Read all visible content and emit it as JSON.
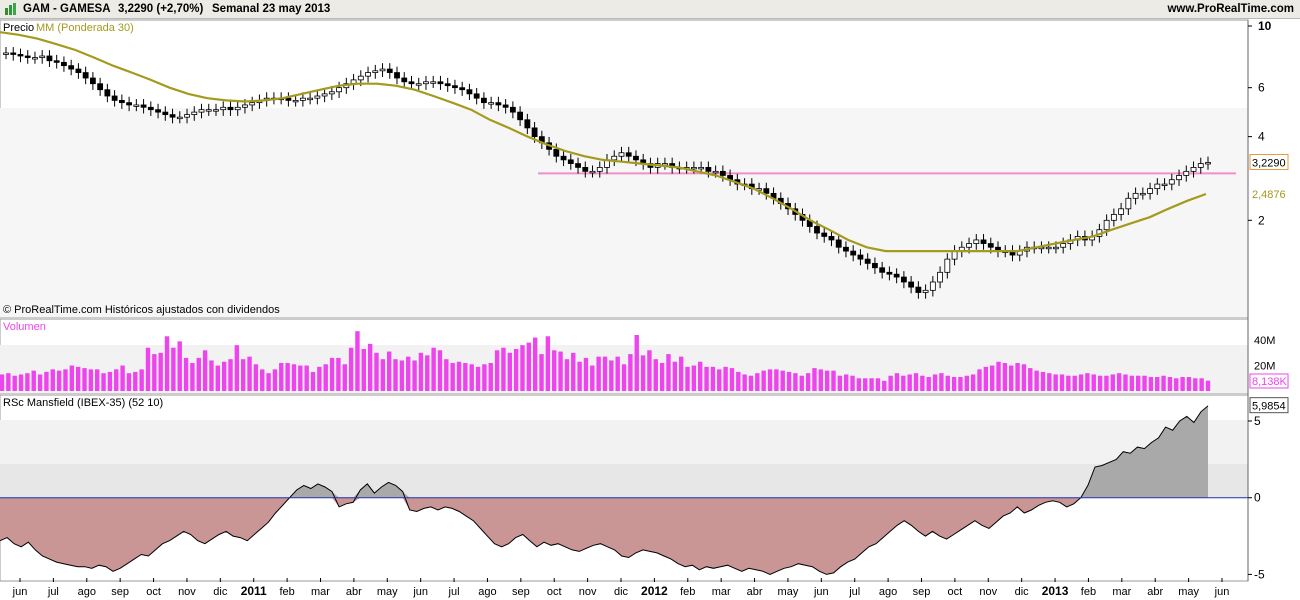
{
  "header": {
    "symbol": "GAM - GAMESA",
    "price_change": "3,2290 (+2,70%)",
    "period": "Semanal  23 may 2013",
    "site": "www.ProRealTime.com",
    "chart_icon": "bar-chart-icon"
  },
  "panels": {
    "price": {
      "label": "Precio",
      "ma_label": "MM (Ponderada 30)",
      "copyright": "© ProRealTime.com  Históricos ajustados con dividendos",
      "last_price_tag": "3,2290",
      "ma_tag": "2,4876",
      "y_ticks": [
        "10",
        "6",
        "4",
        "2"
      ]
    },
    "volume": {
      "label": "Volumen",
      "last_tag": "8,138K",
      "y_ticks": [
        "40M",
        "20M"
      ]
    },
    "rsc": {
      "label": "RSc Mansfield (IBEX-35) (52 10)",
      "last_tag": "5,9854",
      "y_ticks": [
        "5",
        "0",
        "-5"
      ]
    }
  },
  "x_axis": [
    "jun",
    "jul",
    "ago",
    "sep",
    "oct",
    "nov",
    "dic",
    "2011",
    "feb",
    "mar",
    "abr",
    "may",
    "jun",
    "jul",
    "ago",
    "sep",
    "oct",
    "nov",
    "dic",
    "2012",
    "feb",
    "mar",
    "abr",
    "may",
    "jun",
    "jul",
    "ago",
    "sep",
    "oct",
    "nov",
    "dic",
    "2013",
    "feb",
    "mar",
    "abr",
    "may",
    "jun"
  ],
  "colors": {
    "ma": "#a49a1e",
    "volume": "#ee44ee",
    "rsc_negative": "#c99595",
    "rsc_positive": "#a9a9a9",
    "hline": "#f090c8",
    "zero_line": "#2233aa"
  },
  "chart_data": [
    {
      "type": "line",
      "title": "GAM - GAMESA",
      "series": [
        {
          "name": "Precio",
          "values": [
            8.0,
            7.9,
            7.8,
            7.7,
            7.7,
            7.8,
            7.5,
            7.4,
            7.2,
            7.0,
            6.8,
            6.5,
            6.2,
            5.9,
            5.6,
            5.4,
            5.3,
            5.2,
            5.2,
            5.1,
            5.0,
            4.9,
            4.8,
            4.7,
            4.7,
            4.8,
            4.9,
            5.0,
            5.0,
            5.0,
            5.1,
            5.0,
            5.1,
            5.2,
            5.3,
            5.4,
            5.5,
            5.5,
            5.5,
            5.4,
            5.4,
            5.5,
            5.5,
            5.6,
            5.7,
            5.8,
            6.0,
            6.2,
            6.4,
            6.6,
            6.8,
            6.9,
            7.0,
            6.8,
            6.5,
            6.3,
            6.2,
            6.2,
            6.3,
            6.3,
            6.2,
            6.1,
            6.0,
            5.9,
            5.7,
            5.5,
            5.3,
            5.3,
            5.2,
            5.1,
            4.9,
            4.6,
            4.3,
            4.0,
            3.8,
            3.6,
            3.4,
            3.3,
            3.2,
            3.1,
            3.0,
            3.0,
            3.1,
            3.3,
            3.4,
            3.5,
            3.4,
            3.3,
            3.2,
            3.1,
            3.2,
            3.2,
            3.1,
            3.1,
            3.1,
            3.1,
            3.1,
            3.0,
            3.0,
            2.9,
            2.8,
            2.7,
            2.7,
            2.6,
            2.6,
            2.5,
            2.4,
            2.3,
            2.2,
            2.1,
            2.0,
            1.9,
            1.8,
            1.75,
            1.7,
            1.6,
            1.55,
            1.5,
            1.45,
            1.4,
            1.35,
            1.3,
            1.28,
            1.25,
            1.2,
            1.15,
            1.1,
            1.12,
            1.2,
            1.3,
            1.45,
            1.55,
            1.6,
            1.65,
            1.7,
            1.65,
            1.6,
            1.55,
            1.55,
            1.5,
            1.55,
            1.6,
            1.6,
            1.6,
            1.6,
            1.6,
            1.65,
            1.7,
            1.75,
            1.7,
            1.75,
            1.85,
            2.0,
            2.1,
            2.2,
            2.4,
            2.5,
            2.5,
            2.6,
            2.7,
            2.7,
            2.8,
            2.9,
            3.0,
            3.1,
            3.2,
            3.229
          ]
        },
        {
          "name": "MM (Ponderada 30)",
          "values": [
            9.5,
            9.3,
            9.0,
            8.6,
            8.2,
            7.7,
            7.2,
            6.8,
            6.4,
            6.0,
            5.7,
            5.5,
            5.4,
            5.35,
            5.4,
            5.5,
            5.7,
            5.9,
            6.1,
            6.2,
            6.2,
            6.1,
            5.9,
            5.6,
            5.3,
            5.0,
            4.6,
            4.3,
            4.0,
            3.75,
            3.55,
            3.4,
            3.3,
            3.25,
            3.2,
            3.15,
            3.1,
            3.0,
            2.9,
            2.75,
            2.6,
            2.4,
            2.2,
            2.0,
            1.85,
            1.7,
            1.6,
            1.55,
            1.55,
            1.55,
            1.55,
            1.55,
            1.55,
            1.55,
            1.55,
            1.6,
            1.65,
            1.7,
            1.75,
            1.85,
            1.95,
            2.05,
            2.2,
            2.35,
            2.4876
          ]
        }
      ],
      "ylim": [
        1.0,
        10
      ],
      "log_scale": true,
      "horizontal_line": 2.95,
      "last_price": 3.229
    },
    {
      "type": "bar",
      "title": "Volumen",
      "values": [
        13,
        14,
        12,
        13,
        14,
        16,
        13,
        15,
        17,
        16,
        17,
        20,
        19,
        18,
        17,
        17,
        14,
        15,
        17,
        20,
        14,
        15,
        17,
        34,
        29,
        30,
        43,
        34,
        39,
        26,
        22,
        26,
        32,
        24,
        20,
        23,
        25,
        36,
        25,
        27,
        21,
        17,
        14,
        17,
        22,
        22,
        21,
        20,
        20,
        15,
        19,
        21,
        26,
        26,
        21,
        34,
        47,
        33,
        37,
        30,
        25,
        31,
        25,
        24,
        27,
        24,
        30,
        28,
        34,
        32,
        25,
        22,
        23,
        22,
        21,
        19,
        21,
        22,
        32,
        34,
        30,
        33,
        36,
        38,
        42,
        29,
        43,
        32,
        31,
        25,
        30,
        23,
        26,
        20,
        27,
        27,
        24,
        27,
        21,
        29,
        44,
        28,
        32,
        25,
        22,
        29,
        23,
        27,
        19,
        20,
        23,
        19,
        19,
        17,
        19,
        18,
        15,
        13,
        12,
        14,
        16,
        17,
        17,
        16,
        15,
        14,
        12,
        14,
        18,
        17,
        16,
        16,
        12,
        13,
        12,
        10,
        10,
        10,
        10,
        8,
        12,
        14,
        12,
        13,
        14,
        12,
        11,
        13,
        14,
        12,
        11,
        11,
        12,
        13,
        17,
        19,
        20,
        23,
        22,
        20,
        22,
        21,
        18,
        16,
        15,
        14,
        13,
        13,
        12,
        12,
        13,
        14,
        13,
        12,
        12,
        13,
        14,
        13,
        12,
        12,
        12,
        11,
        11,
        12,
        11,
        10,
        11,
        11,
        10,
        10,
        8.138
      ],
      "ylabel": "",
      "ylim": [
        0,
        55
      ]
    },
    {
      "type": "area",
      "title": "RSc Mansfield (IBEX-35) (52 10)",
      "values": [
        -2.8,
        -2.6,
        -3.0,
        -3.2,
        -2.9,
        -3.4,
        -3.8,
        -4.0,
        -4.2,
        -4.3,
        -4.4,
        -4.5,
        -4.5,
        -4.6,
        -4.4,
        -4.5,
        -4.8,
        -4.6,
        -4.3,
        -4.0,
        -3.7,
        -3.8,
        -3.4,
        -3.0,
        -2.8,
        -2.5,
        -2.2,
        -2.4,
        -2.8,
        -3.0,
        -2.7,
        -2.4,
        -2.2,
        -2.5,
        -2.6,
        -2.8,
        -2.4,
        -2.0,
        -1.6,
        -1.0,
        -0.5,
        0.0,
        0.5,
        0.8,
        0.6,
        0.9,
        0.7,
        0.4,
        -0.6,
        -0.4,
        -0.3,
        0.5,
        0.9,
        0.3,
        0.7,
        1.0,
        0.8,
        0.4,
        -0.8,
        -0.9,
        -0.7,
        -0.6,
        -0.8,
        -0.6,
        -0.7,
        -0.9,
        -1.2,
        -1.5,
        -2.0,
        -2.5,
        -3.0,
        -3.2,
        -3.0,
        -2.6,
        -2.4,
        -2.8,
        -3.2,
        -2.9,
        -3.1,
        -3.0,
        -3.2,
        -3.4,
        -3.5,
        -3.3,
        -3.1,
        -3.0,
        -3.2,
        -3.4,
        -3.8,
        -3.9,
        -3.6,
        -3.4,
        -3.5,
        -3.6,
        -3.8,
        -4.0,
        -4.3,
        -4.5,
        -4.4,
        -4.7,
        -4.5,
        -4.6,
        -4.5,
        -4.4,
        -4.6,
        -4.8,
        -4.6,
        -4.7,
        -4.8,
        -5.0,
        -4.8,
        -4.6,
        -4.5,
        -4.3,
        -4.4,
        -4.5,
        -4.8,
        -5.0,
        -4.9,
        -4.5,
        -4.2,
        -4.0,
        -3.6,
        -3.2,
        -3.0,
        -2.6,
        -2.2,
        -1.8,
        -1.5,
        -1.8,
        -2.2,
        -2.5,
        -2.2,
        -2.5,
        -2.7,
        -2.4,
        -2.1,
        -1.8,
        -1.5,
        -1.8,
        -2.0,
        -1.6,
        -1.2,
        -1.0,
        -0.6,
        -1.0,
        -0.8,
        -0.5,
        -0.3,
        -0.2,
        -0.3,
        -0.6,
        -0.4,
        0.0,
        0.8,
        2.0,
        2.1,
        2.3,
        2.5,
        3.0,
        2.9,
        3.3,
        3.2,
        3.6,
        3.9,
        4.6,
        4.4,
        5.0,
        5.3,
        4.9,
        5.6,
        5.985
      ],
      "ylim": [
        -5.3,
        6.5
      ]
    }
  ]
}
